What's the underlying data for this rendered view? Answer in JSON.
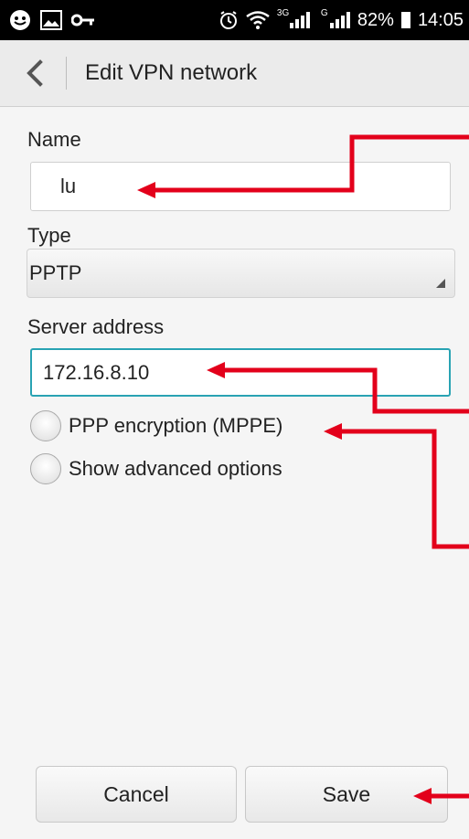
{
  "status_bar": {
    "battery": "82%",
    "time": "14:05",
    "network_1": "3G",
    "network_2": "G"
  },
  "action_bar": {
    "title": "Edit VPN network"
  },
  "form": {
    "name_label": "Name",
    "name_value": "lu",
    "type_label": "Type",
    "type_value": "PPTP",
    "server_label": "Server address",
    "server_value": "172.16.8.10",
    "ppp_label": "PPP encryption (MPPE)",
    "advanced_label": "Show advanced options"
  },
  "buttons": {
    "cancel": "Cancel",
    "save": "Save"
  },
  "colors": {
    "focus": "#29a3b3",
    "annotation": "#e3001b"
  },
  "icons": [
    "smiley-icon",
    "image-icon",
    "key-icon",
    "alarm-icon",
    "wifi-icon",
    "signal-icon",
    "battery-icon",
    "back-arrow-icon"
  ]
}
